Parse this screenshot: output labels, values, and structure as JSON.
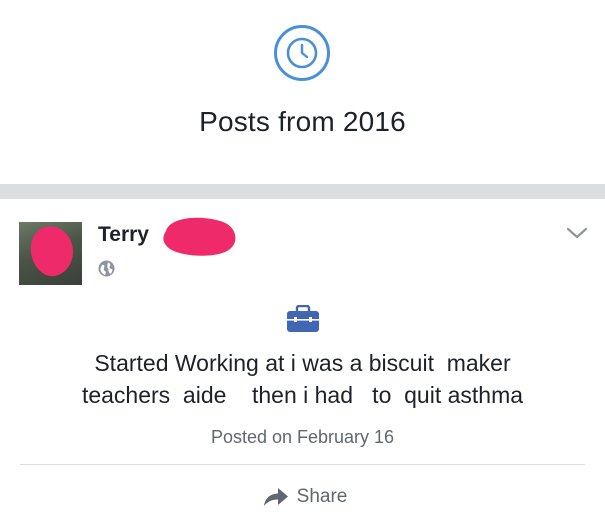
{
  "memory": {
    "title": "Posts from 2016",
    "icon": "clock-icon",
    "accent_color": "#4a90d9"
  },
  "post": {
    "author": "Terry",
    "privacy_icon": "globe-icon",
    "activity_icon": "briefcase-icon",
    "text_line1": "Started Working at i was a biscuit  maker",
    "text_line2": "teachers  aide    then i had   to  quit asthma",
    "date": "Posted on February 16",
    "redaction_color": "#ee2a6a",
    "briefcase_color": "#4267b2"
  },
  "actions": {
    "share_label": "Share"
  }
}
